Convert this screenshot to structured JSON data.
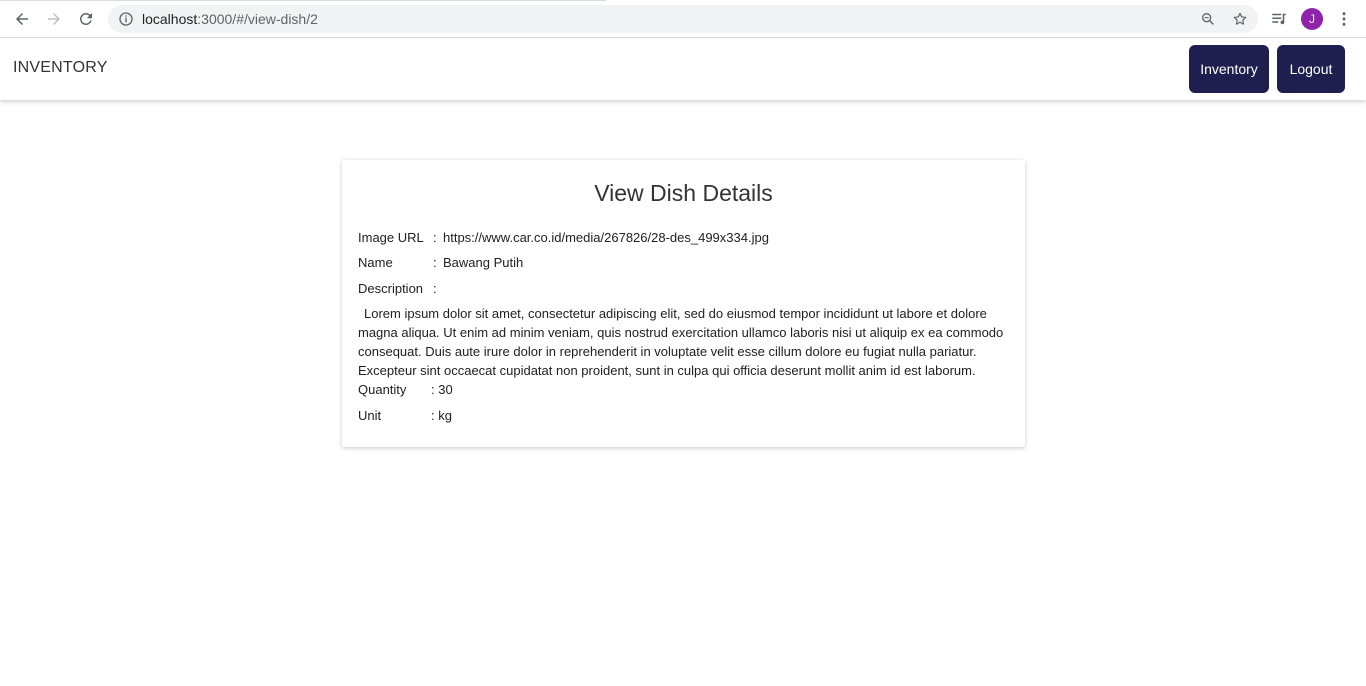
{
  "browser": {
    "url_host": "localhost",
    "url_rest": ":3000/#/view-dish/2",
    "profile_initial": "J"
  },
  "app": {
    "title": "INVENTORY",
    "inventory_button": "Inventory",
    "logout_button": "Logout"
  },
  "card": {
    "title": "View Dish Details",
    "image_url_label": "Image URL",
    "image_url_sep": ":",
    "image_url_value": "https://www.car.co.id/media/267826/28-des_499x334.jpg",
    "name_label": "Name",
    "name_sep": ":",
    "name_value": "Bawang Putih",
    "description_label": "Description",
    "description_sep": ":",
    "description_value": "Lorem ipsum dolor sit amet, consectetur adipiscing elit, sed do eiusmod tempor incididunt ut labore et dolore magna aliqua. Ut enim ad minim veniam, quis nostrud exercitation ullamco laboris nisi ut aliquip ex ea commodo consequat. Duis aute irure dolor in reprehenderit in voluptate velit esse cillum dolore eu fugiat nulla pariatur. Excepteur sint occaecat cupidatat non proident, sunt in culpa qui officia deserunt mollit anim id est laborum.",
    "quantity_label": "Quantity",
    "quantity_value": ": 30",
    "unit_label": "Unit",
    "unit_value": ": kg"
  },
  "colors": {
    "button_bg": "#1f1f4f",
    "avatar_bg": "#8e24aa"
  }
}
